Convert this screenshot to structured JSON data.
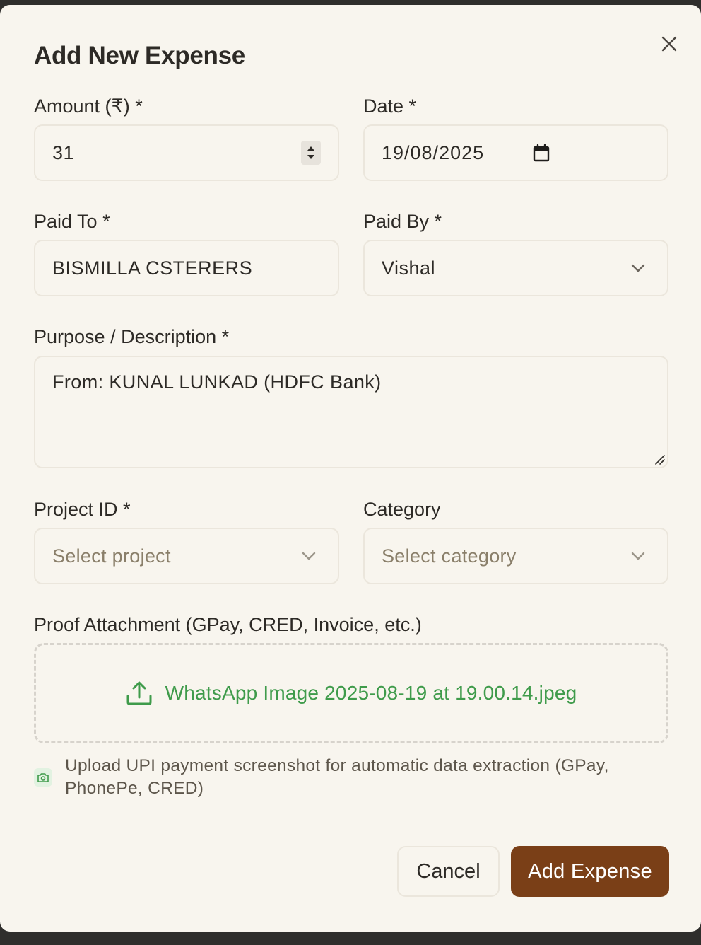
{
  "dialog": {
    "title": "Add New Expense",
    "close_icon": "close-icon"
  },
  "amount": {
    "label": "Amount (₹) *",
    "value": "31"
  },
  "date": {
    "label": "Date *",
    "value": "19/08/2025",
    "icon": "calendar-icon"
  },
  "paid_to": {
    "label": "Paid To *",
    "value": "BISMILLA CSTERERS"
  },
  "paid_by": {
    "label": "Paid By *",
    "selected": "Vishal"
  },
  "purpose": {
    "label": "Purpose / Description *",
    "value": "From: KUNAL LUNKAD (HDFC Bank)"
  },
  "project": {
    "label": "Project ID *",
    "placeholder": "Select project"
  },
  "category": {
    "label": "Category",
    "placeholder": "Select category"
  },
  "proof": {
    "label": "Proof Attachment (GPay, CRED, Invoice, etc.)",
    "file_name": "WhatsApp Image 2025-08-19 at 19.00.14.jpeg",
    "icon": "upload-icon",
    "hint": "Upload UPI payment screenshot for automatic data extraction (GPay, PhonePe, CRED)",
    "hint_icon": "camera-icon"
  },
  "actions": {
    "cancel": "Cancel",
    "submit": "Add Expense"
  },
  "colors": {
    "background": "#f8f5ee",
    "primary_button": "#7a3f17",
    "file_link": "#3f9b4b",
    "border": "#ebe6dc"
  }
}
